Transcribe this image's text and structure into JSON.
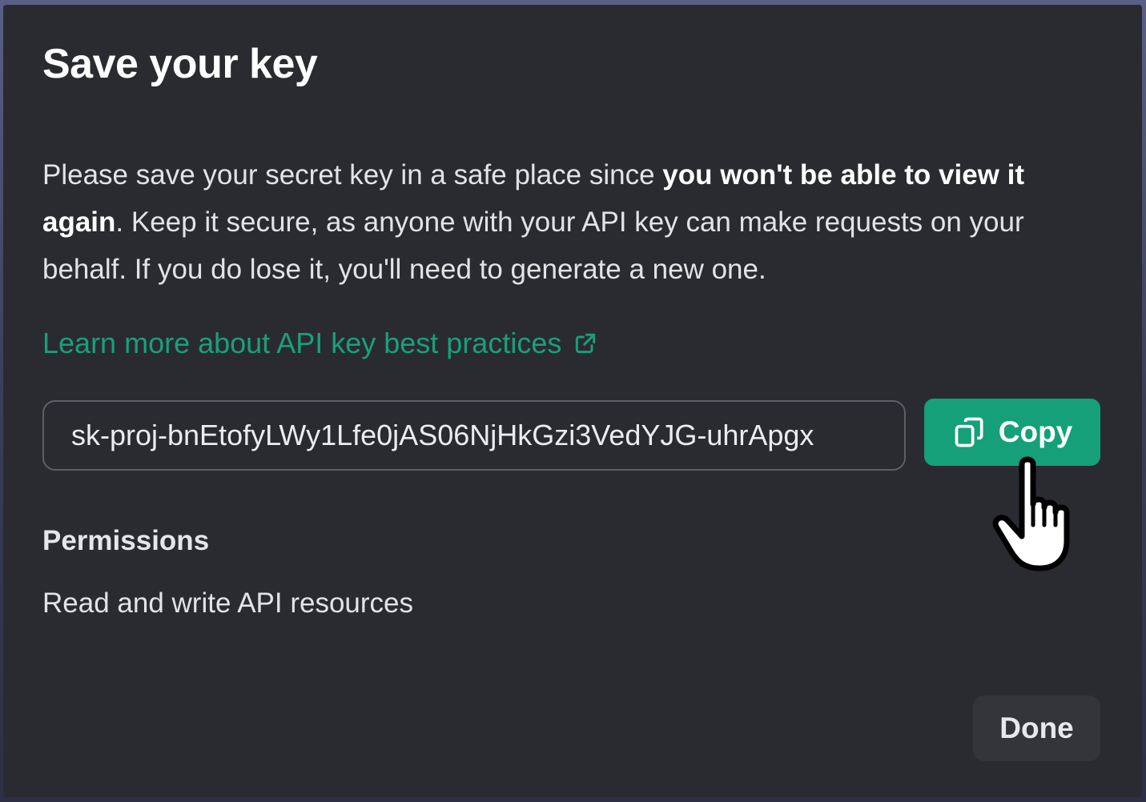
{
  "dialog": {
    "title": "Save your key",
    "description": {
      "part1": "Please save your secret key in a safe place since ",
      "bold": "you won't be able to view it again",
      "part2": ". Keep it secure, as anyone with your API key can make requests on your behalf. If you do lose it, you'll need to generate a new one."
    },
    "learn_more_link": "Learn more about API key best practices",
    "key_value": "sk-proj-bnEtofyLWy1Lfe0jAS06NjHkGzi3VedYJG-uhrApgx",
    "copy_button_label": "Copy",
    "permissions": {
      "heading": "Permissions",
      "value": "Read and write API resources"
    },
    "done_button_label": "Done"
  },
  "icons": {
    "external_link": "external-link-icon",
    "copy": "copy-icon",
    "cursor": "hand-pointer-cursor"
  },
  "colors": {
    "modal_bg": "#2a2b30",
    "accent_green": "#15a07a",
    "link_green": "#19a07a",
    "text": "#e3e3e6"
  }
}
